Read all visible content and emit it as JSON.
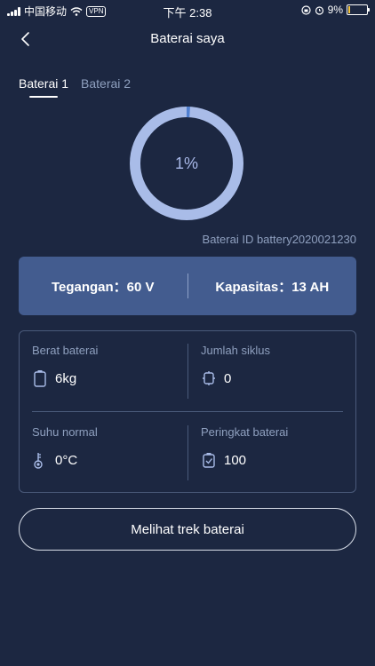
{
  "status_bar": {
    "carrier": "中国移动",
    "vpn": "VPN",
    "time": "下午 2:38",
    "battery_percent": "9%"
  },
  "header": {
    "title": "Baterai saya",
    "back_icon": "chevron-left-icon"
  },
  "tabs": [
    {
      "label": "Baterai 1",
      "active": true
    },
    {
      "label": "Baterai 2",
      "active": false
    }
  ],
  "gauge": {
    "percent_label": "1%",
    "level": 0.01,
    "track_color": "#a9bce8",
    "fill_color": "#4f7fd0"
  },
  "battery_id": "Baterai ID battery2020021230",
  "specs": {
    "voltage": "Tegangan：60 V",
    "capacity": "Kapasitas：13 AH"
  },
  "info": {
    "weight": {
      "label": "Berat baterai",
      "value": "6kg",
      "icon": "battery-icon"
    },
    "cycles": {
      "label": "Jumlah siklus",
      "value": "0",
      "icon": "cycle-icon"
    },
    "temperature": {
      "label": "Suhu normal",
      "value": "0°C",
      "icon": "thermometer-icon"
    },
    "rating": {
      "label": "Peringkat baterai",
      "value": "100",
      "icon": "rating-icon"
    }
  },
  "actions": {
    "track_button": "Melihat trek baterai"
  },
  "colors": {
    "background": "#1c2741",
    "spec_bar": "#435c8f",
    "muted_text": "#8fa0bf"
  }
}
